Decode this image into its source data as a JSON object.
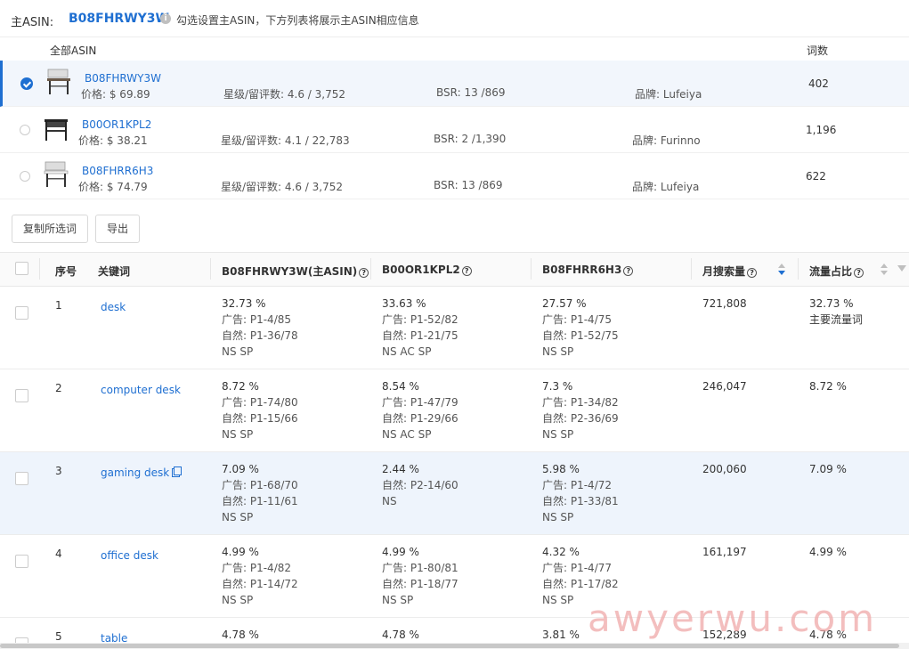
{
  "header": {
    "main_asin_label": "主ASIN:",
    "main_asin": "B08FHRWY3W",
    "hint": "勾选设置主ASIN，下方列表将展示主ASIN相应信息"
  },
  "asin_list": {
    "all_label": "全部ASIN",
    "count_label": "词数",
    "items": [
      {
        "asin": "B08FHRWY3W",
        "price": "价格:   $ 69.89",
        "star": "星级/留评数:   4.6 / 3,752",
        "bsr": "BSR:  13 /869",
        "brand": "品牌:  Lufeiya",
        "words": "402",
        "selected": true
      },
      {
        "asin": "B00OR1KPL2",
        "price": "价格:   $ 38.21",
        "star": "星级/留评数:   4.1 / 22,783",
        "bsr": "BSR:  2 /1,390",
        "brand": "品牌:  Furinno",
        "words": "1,196",
        "selected": false
      },
      {
        "asin": "B08FHRR6H3",
        "price": "价格:   $ 74.79",
        "star": "星级/留评数:   4.6 / 3,752",
        "bsr": "BSR:  13 /869",
        "brand": "品牌:  Lufeiya",
        "words": "622",
        "selected": false
      }
    ]
  },
  "toolbar": {
    "copy_label": "复制所选词",
    "export_label": "导出"
  },
  "table": {
    "headers": {
      "index": "序号",
      "keyword": "关键词",
      "asin1": "B08FHRWY3W(主ASIN)",
      "asin2": "B00OR1KPL2",
      "asin3": "B08FHRR6H3",
      "volume": "月搜索量",
      "share": "流量占比"
    },
    "rows": [
      {
        "idx": "1",
        "kw": "desk",
        "a1": [
          "32.73 %",
          "广告:   P1-4/85",
          "自然:   P1-36/78",
          "NS SP"
        ],
        "a2": [
          "33.63 %",
          "广告:   P1-52/82",
          "自然:   P1-21/75",
          "NS AC SP"
        ],
        "a3": [
          "27.57 %",
          "广告:   P1-4/75",
          "自然:   P1-52/75",
          "NS SP"
        ],
        "vol": "721,808",
        "share": [
          "32.73 %",
          "主要流量词"
        ]
      },
      {
        "idx": "2",
        "kw": "computer desk",
        "a1": [
          "8.72 %",
          "广告:   P1-74/80",
          "自然:   P1-15/66",
          "NS SP"
        ],
        "a2": [
          "8.54 %",
          "广告:   P1-47/79",
          "自然:   P1-29/66",
          "NS AC SP"
        ],
        "a3": [
          "7.3 %",
          "广告:   P1-34/82",
          "自然:   P2-36/69",
          "NS SP"
        ],
        "vol": "246,047",
        "share": [
          "8.72 %"
        ]
      },
      {
        "idx": "3",
        "kw": "gaming desk",
        "a1": [
          "7.09 %",
          "广告:   P1-68/70",
          "自然:   P1-11/61",
          "NS SP"
        ],
        "a2": [
          "2.44 %",
          "自然:   P2-14/60",
          "NS"
        ],
        "a3": [
          "5.98 %",
          "广告:   P1-4/72",
          "自然:   P1-33/81",
          "NS SP"
        ],
        "vol": "200,060",
        "share": [
          "7.09 %"
        ]
      },
      {
        "idx": "4",
        "kw": "office desk",
        "a1": [
          "4.99 %",
          "广告:   P1-4/82",
          "自然:   P1-14/72",
          "NS SP"
        ],
        "a2": [
          "4.99 %",
          "广告:   P1-80/81",
          "自然:   P1-18/77",
          "NS SP"
        ],
        "a3": [
          "4.32 %",
          "广告:   P1-4/77",
          "自然:   P1-17/82",
          "NS SP"
        ],
        "vol": "161,197",
        "share": [
          "4.99 %"
        ]
      },
      {
        "idx": "5",
        "kw": "table",
        "a1": [
          "4.78 %"
        ],
        "a2": [
          "4.78 %"
        ],
        "a3": [
          "3.81 %"
        ],
        "vol": "152,289",
        "share": [
          "4.78 %"
        ]
      }
    ]
  },
  "watermark": "awyerwu.com",
  "colors": {
    "accent": "#1f6fd1",
    "selected_row": "#f2f6fc",
    "hover_row": "#eef4fc"
  }
}
